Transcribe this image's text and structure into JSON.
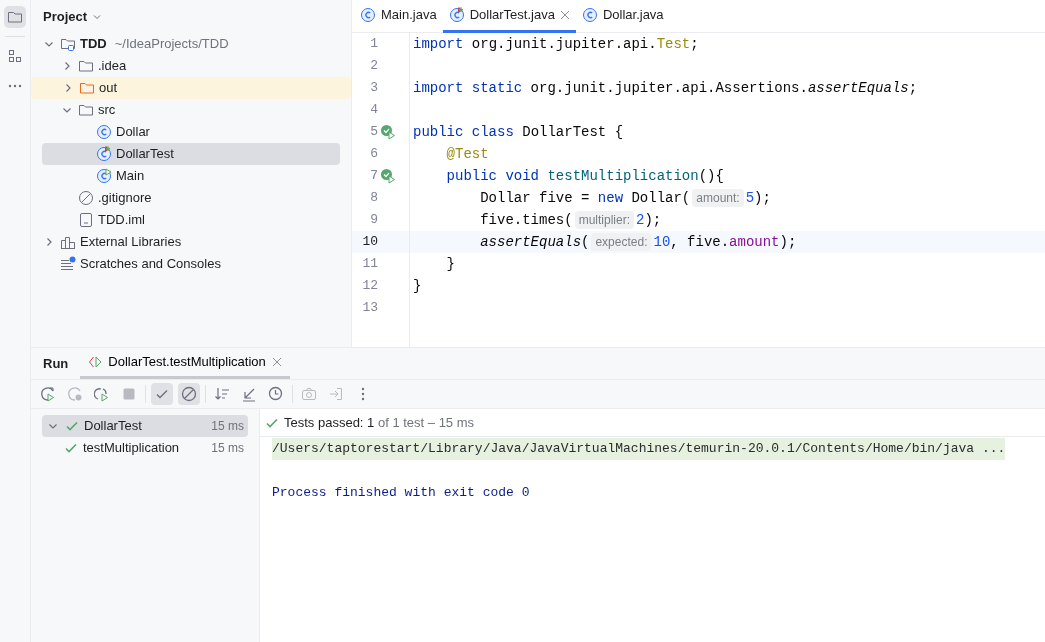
{
  "project_panel": {
    "title": "Project",
    "tree": [
      {
        "label": "TDD",
        "suffix": "~/IdeaProjects/TDD",
        "kind": "project",
        "expanded": true,
        "selected": false,
        "children": [
          {
            "label": ".idea",
            "kind": "folder",
            "expanded": false,
            "selected": false
          },
          {
            "label": "out",
            "kind": "excluded-folder",
            "expanded": false,
            "selected": false
          },
          {
            "label": "src",
            "kind": "folder",
            "expanded": true,
            "selected": false,
            "children": [
              {
                "label": "Dollar",
                "kind": "class",
                "selected": false
              },
              {
                "label": "DollarTest",
                "kind": "test-class",
                "selected": true
              },
              {
                "label": "Main",
                "kind": "main-class",
                "selected": false
              }
            ]
          },
          {
            "label": ".gitignore",
            "kind": "ignore",
            "selected": false
          },
          {
            "label": "TDD.iml",
            "kind": "iml",
            "selected": false
          }
        ]
      },
      {
        "label": "External Libraries",
        "kind": "library",
        "expanded": false,
        "selected": false
      },
      {
        "label": "Scratches and Consoles",
        "kind": "scratches",
        "selected": false
      }
    ]
  },
  "editor": {
    "tabs": [
      {
        "label": "Main.java",
        "kind": "class",
        "selected": false,
        "closable": false
      },
      {
        "label": "DollarTest.java",
        "kind": "test-class",
        "selected": true,
        "closable": true
      },
      {
        "label": "Dollar.java",
        "kind": "class",
        "selected": false,
        "closable": false
      }
    ],
    "lines": [
      {
        "number": "1",
        "current": false,
        "run": false,
        "segments": [
          {
            "kind": "code",
            "tokens": [
              {
                "text": "import",
                "kind": "keyword"
              },
              {
                "text": " org.junit.jupiter.api.",
                "kind": "plain"
              },
              {
                "text": "Test",
                "kind": "annotation"
              },
              {
                "text": ";",
                "kind": "plain"
              }
            ]
          }
        ]
      },
      {
        "number": "2",
        "current": false,
        "run": false
      },
      {
        "number": "3",
        "current": false,
        "run": false,
        "segments": [
          {
            "kind": "code",
            "tokens": [
              {
                "text": "import static",
                "kind": "keyword"
              },
              {
                "text": " org.junit.jupiter.api.Assertions.",
                "kind": "plain"
              },
              {
                "text": "assertEquals",
                "kind": "static-call"
              },
              {
                "text": ";",
                "kind": "plain"
              }
            ]
          }
        ]
      },
      {
        "number": "4",
        "current": false,
        "run": false
      },
      {
        "number": "5",
        "current": false,
        "run": true,
        "segments": [
          {
            "kind": "code",
            "tokens": [
              {
                "text": "public class",
                "kind": "keyword"
              },
              {
                "text": " DollarTest {",
                "kind": "plain"
              }
            ]
          }
        ]
      },
      {
        "number": "6",
        "current": false,
        "run": false,
        "segments": [
          {
            "kind": "code",
            "tokens": [
              {
                "text": "    @Test",
                "kind": "annotation"
              }
            ]
          }
        ]
      },
      {
        "number": "7",
        "current": false,
        "run": true,
        "segments": [
          {
            "kind": "code",
            "tokens": [
              {
                "text": "    public void",
                "kind": "keyword"
              },
              {
                "text": " testMultiplication",
                "kind": "method"
              },
              {
                "text": "(){",
                "kind": "plain"
              }
            ]
          }
        ]
      },
      {
        "number": "8",
        "current": false,
        "run": false,
        "segments": [
          {
            "kind": "code",
            "tokens": [
              {
                "text": "        Dollar five = ",
                "kind": "plain"
              },
              {
                "text": "new",
                "kind": "keyword"
              },
              {
                "text": " Dollar(",
                "kind": "plain"
              }
            ]
          },
          {
            "kind": "hint",
            "text": "amount:"
          },
          {
            "kind": "code",
            "tokens": [
              {
                "text": "5",
                "kind": "number"
              },
              {
                "text": ");",
                "kind": "plain"
              }
            ]
          }
        ]
      },
      {
        "number": "9",
        "current": false,
        "run": false,
        "segments": [
          {
            "kind": "code",
            "tokens": [
              {
                "text": "        five.times(",
                "kind": "plain"
              }
            ]
          },
          {
            "kind": "hint",
            "text": "multiplier:"
          },
          {
            "kind": "code",
            "tokens": [
              {
                "text": "2",
                "kind": "number"
              },
              {
                "text": ");",
                "kind": "plain"
              }
            ]
          }
        ]
      },
      {
        "number": "10",
        "current": true,
        "run": false,
        "segments": [
          {
            "kind": "code",
            "tokens": [
              {
                "text": "        assertEquals",
                "kind": "static-call"
              },
              {
                "text": "(",
                "kind": "plain"
              }
            ]
          },
          {
            "kind": "hint",
            "text": "expected:"
          },
          {
            "kind": "code",
            "tokens": [
              {
                "text": "10",
                "kind": "number"
              },
              {
                "text": ", five.",
                "kind": "plain"
              },
              {
                "text": "amount",
                "kind": "field"
              },
              {
                "text": ");",
                "kind": "plain"
              }
            ]
          }
        ]
      },
      {
        "number": "11",
        "current": false,
        "run": false,
        "segments": [
          {
            "kind": "code",
            "tokens": [
              {
                "text": "    }",
                "kind": "plain"
              }
            ]
          }
        ]
      },
      {
        "number": "12",
        "current": false,
        "run": false,
        "segments": [
          {
            "kind": "code",
            "tokens": [
              {
                "text": "}",
                "kind": "plain"
              }
            ]
          }
        ]
      },
      {
        "number": "13",
        "current": false,
        "run": false
      }
    ]
  },
  "run_panel": {
    "title": "Run",
    "tab": {
      "label": "DollarTest.testMultiplication",
      "selected": true
    },
    "toolbar": [
      {
        "kind": "rerun",
        "disabled": false,
        "toggled": false
      },
      {
        "kind": "rerun-failed",
        "disabled": true,
        "toggled": false
      },
      {
        "kind": "toggle-auto",
        "disabled": false,
        "toggled": false
      },
      {
        "kind": "stop",
        "disabled": true,
        "toggled": false
      },
      {
        "kind": "sep"
      },
      {
        "kind": "show-passed",
        "disabled": false,
        "toggled": true
      },
      {
        "kind": "show-ignored",
        "disabled": false,
        "toggled": true
      },
      {
        "kind": "sep"
      },
      {
        "kind": "sort",
        "disabled": false,
        "toggled": false
      },
      {
        "kind": "collapse",
        "disabled": false,
        "toggled": false
      },
      {
        "kind": "history",
        "disabled": false,
        "toggled": false
      },
      {
        "kind": "sep"
      },
      {
        "kind": "camera",
        "disabled": true,
        "toggled": false
      },
      {
        "kind": "import",
        "disabled": true,
        "toggled": false
      },
      {
        "kind": "more",
        "disabled": false,
        "toggled": false
      }
    ],
    "tests": [
      {
        "label": "DollarTest",
        "time": "15 ms",
        "passed": true,
        "expanded": true,
        "selected": true,
        "children": [
          {
            "label": "testMultiplication",
            "time": "15 ms",
            "passed": true,
            "selected": false
          }
        ]
      }
    ],
    "summary": {
      "label": "Tests passed:",
      "count": "1",
      "detail": "of 1 test – 15 ms"
    },
    "console": [
      {
        "kind": "command",
        "text": "/Users/taptorestart/Library/Java/JavaVirtualMachines/temurin-20.0.1/Contents/Home/bin/java ..."
      },
      {
        "kind": "blank"
      },
      {
        "kind": "output",
        "text": "Process finished with exit code 0"
      }
    ]
  }
}
